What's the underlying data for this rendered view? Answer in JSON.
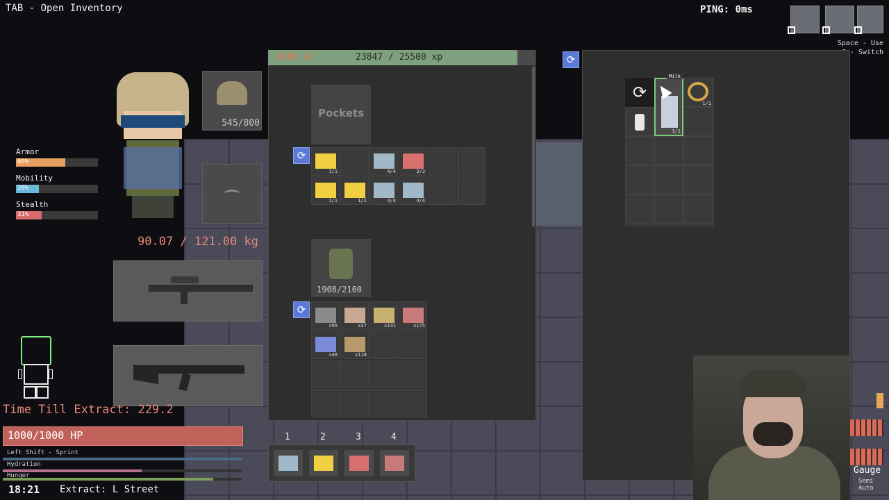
{
  "hud": {
    "tab_hint": "TAB - Open Inventory",
    "ping": "PING: 0ms",
    "space_hint": "Space - Use",
    "switch_hint": "G - Switch"
  },
  "player": {
    "helmet_durability": "545/800",
    "stats": [
      {
        "label": "Armor",
        "value": "60%",
        "level": 0.6,
        "color": "#e8a060"
      },
      {
        "label": "Mobility",
        "value": "28%",
        "level": 0.28,
        "color": "#6ab8d8"
      },
      {
        "label": "Stealth",
        "value": "31%",
        "level": 0.31,
        "color": "#d86a6a"
      }
    ],
    "weight": "90.07 / 121.00 kg",
    "time_till_extract": "Time Till Extract: 229.2",
    "hp": "1000/1000 HP",
    "meters": [
      {
        "label": "Left Shift - Sprint",
        "level": 1.0,
        "color": "#4a6a8a"
      },
      {
        "label": "Hydration",
        "level": 0.58,
        "color": "#b87090"
      },
      {
        "label": "Hunger",
        "level": 0.88,
        "color": "#7aa05a"
      }
    ],
    "clock": "18:21",
    "extract_location": "Extract: L Street"
  },
  "inventory": {
    "rank": "RANK:07",
    "xp": "23847 / 25500 xp",
    "xp_level": 0.935,
    "pockets_label": "Pockets",
    "pockets_items": [
      {
        "color": "#f0d040",
        "qty": "1/1"
      },
      {
        "color": "",
        "qty": ""
      },
      {
        "color": "#a0b8c8",
        "qty": "4/4"
      },
      {
        "color": "#d87070",
        "qty": "3/3"
      },
      {
        "color": "",
        "qty": ""
      },
      {
        "color": "",
        "qty": ""
      },
      {
        "color": "#f0d040",
        "qty": "1/1"
      },
      {
        "color": "#f0d040",
        "qty": "1/1"
      },
      {
        "color": "#a0b8c8",
        "qty": "4/4"
      },
      {
        "color": "#a0b8c8",
        "qty": "4/4"
      },
      {
        "color": "",
        "qty": ""
      },
      {
        "color": "",
        "qty": ""
      }
    ],
    "vest_durability": "1908/2100",
    "vest_items": [
      {
        "color": "#8a8a8a",
        "qty": "x96"
      },
      {
        "color": "#c8a890",
        "qty": "x37"
      },
      {
        "color": "#c8b070",
        "qty": "x141"
      },
      {
        "color": "#c87a7a",
        "qty": "x175"
      },
      {
        "color": "#7a8ad8",
        "qty": "x40"
      },
      {
        "color": "#b89a6a",
        "qty": "x118"
      },
      {
        "color": "",
        "qty": ""
      },
      {
        "color": "",
        "qty": ""
      },
      {
        "color": "",
        "qty": ""
      },
      {
        "color": "",
        "qty": ""
      },
      {
        "color": "",
        "qty": ""
      },
      {
        "color": "",
        "qty": ""
      },
      {
        "color": "",
        "qty": ""
      },
      {
        "color": "",
        "qty": ""
      },
      {
        "color": "",
        "qty": ""
      },
      {
        "color": "",
        "qty": ""
      }
    ]
  },
  "hotbar": [
    {
      "num": "1",
      "color": "#a0b8c8"
    },
    {
      "num": "2",
      "color": "#f0d040"
    },
    {
      "num": "3",
      "color": "#d87070"
    },
    {
      "num": "4",
      "color": "#c87a7a"
    }
  ],
  "loot": {
    "tooltip": "Milk",
    "milk_qty": "1/1",
    "pretzel_qty": "1/1"
  },
  "overlay": {
    "ammo_type": "Gauge",
    "fire_mode": "Semi Auto"
  }
}
